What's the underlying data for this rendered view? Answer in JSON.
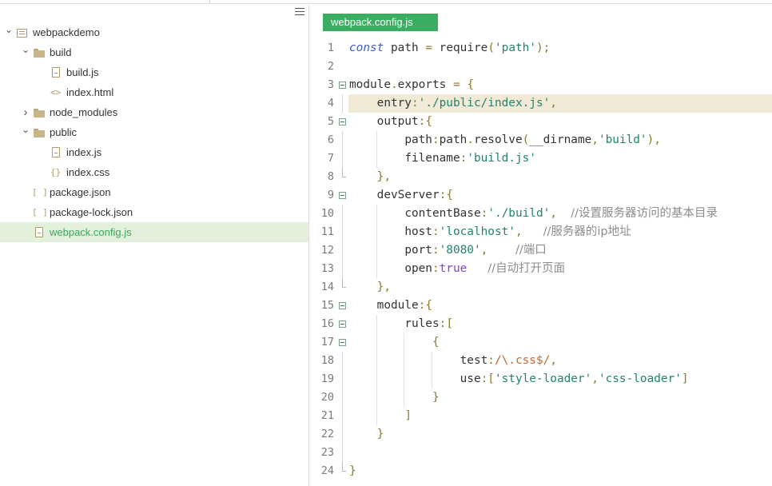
{
  "sidebar": {
    "menu_icon": "menu-icon",
    "items": [
      {
        "label": "webpackdemo",
        "icon": "project-icon",
        "chevron": "down",
        "indent": 0
      },
      {
        "label": "build",
        "icon": "folder-icon",
        "chevron": "down",
        "indent": 1
      },
      {
        "label": "build.js",
        "icon": "file-js-icon",
        "indent": 2
      },
      {
        "label": "index.html",
        "icon": "code-file-icon",
        "indent": 2
      },
      {
        "label": "node_modules",
        "icon": "folder-icon",
        "chevron": "right",
        "indent": 1
      },
      {
        "label": "public",
        "icon": "folder-icon",
        "chevron": "down",
        "indent": 1
      },
      {
        "label": "index.js",
        "icon": "file-js-icon",
        "indent": 2
      },
      {
        "label": "index.css",
        "icon": "css-file-icon",
        "indent": 2
      },
      {
        "label": "package.json",
        "icon": "json-file-icon",
        "indent": 1
      },
      {
        "label": "package-lock.json",
        "icon": "json-file-icon",
        "indent": 1
      },
      {
        "label": "webpack.config.js",
        "icon": "file-js-icon",
        "indent": 1,
        "selected": true
      }
    ]
  },
  "editor": {
    "active_tab": "webpack.config.js",
    "highlighted_line": 4,
    "lines": [
      {
        "n": "1",
        "code": "const path = require('path');"
      },
      {
        "n": "2",
        "code": ""
      },
      {
        "n": "3",
        "code": "module.exports = {"
      },
      {
        "n": "4",
        "code": "    entry:'./public/index.js',"
      },
      {
        "n": "5",
        "code": "    output:{"
      },
      {
        "n": "6",
        "code": "        path:path.resolve(__dirname,'build'),"
      },
      {
        "n": "7",
        "code": "        filename:'build.js'"
      },
      {
        "n": "8",
        "code": "    },"
      },
      {
        "n": "9",
        "code": "    devServer:{"
      },
      {
        "n": "10",
        "code": "        contentBase:'./build',  //设置服务器访问的基本目录"
      },
      {
        "n": "11",
        "code": "        host:'localhost',   //服务器的ip地址"
      },
      {
        "n": "12",
        "code": "        port:'8080',    //端口"
      },
      {
        "n": "13",
        "code": "        open:true   //自动打开页面"
      },
      {
        "n": "14",
        "code": "    },"
      },
      {
        "n": "15",
        "code": "    module:{"
      },
      {
        "n": "16",
        "code": "        rules:["
      },
      {
        "n": "17",
        "code": "            {"
      },
      {
        "n": "18",
        "code": "                test:/\\.css$/,"
      },
      {
        "n": "19",
        "code": "                use:['style-loader','css-loader']"
      },
      {
        "n": "20",
        "code": "            }"
      },
      {
        "n": "21",
        "code": "        ]"
      },
      {
        "n": "22",
        "code": "    }"
      },
      {
        "n": "23",
        "code": ""
      },
      {
        "n": "24",
        "code": "}"
      }
    ]
  },
  "colors": {
    "tab_active_bg": "#3bad60",
    "selected_row_bg": "#e3f0db",
    "selected_text": "#3aa85a",
    "highlight_line_bg": "#f0ead6",
    "string": "#22836e",
    "keyword": "#3a5cc8",
    "comment": "#8c8c8c",
    "boolean": "#8a3fcf",
    "regex": "#c7642a"
  }
}
